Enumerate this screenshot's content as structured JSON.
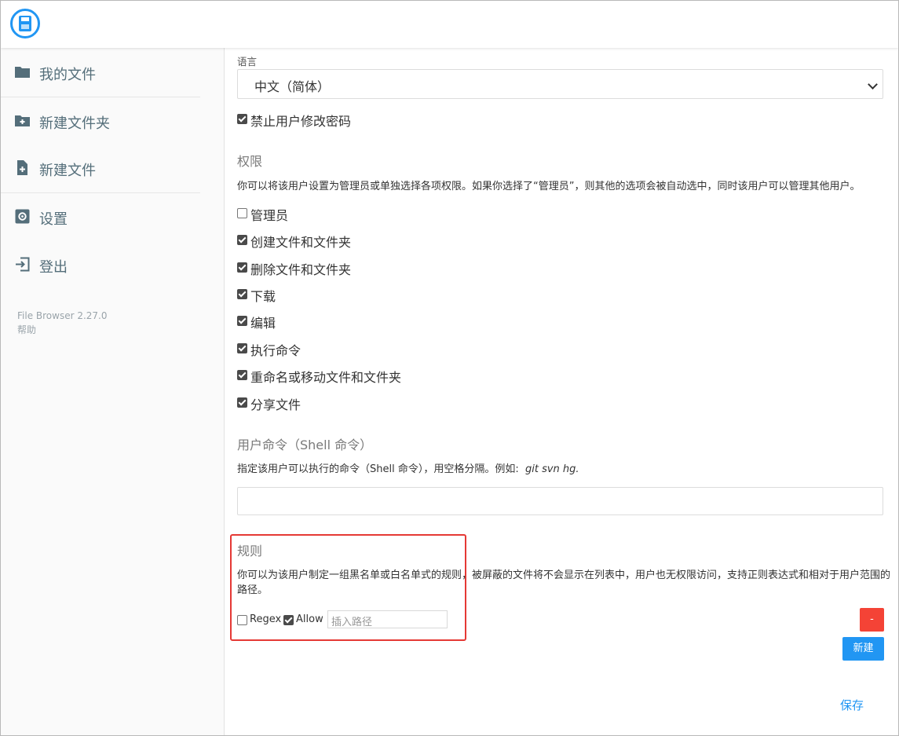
{
  "sidebar": {
    "items": [
      {
        "label": "我的文件",
        "icon": "folder-icon"
      },
      {
        "label": "新建文件夹",
        "icon": "new-folder-icon"
      },
      {
        "label": "新建文件",
        "icon": "new-file-icon"
      },
      {
        "label": "设置",
        "icon": "settings-icon"
      },
      {
        "label": "登出",
        "icon": "logout-icon"
      }
    ],
    "version": "File Browser 2.27.0",
    "help": "帮助"
  },
  "form": {
    "language_label": "语言",
    "language_value": "中文（简体）",
    "lock_password": {
      "label": "禁止用户修改密码",
      "checked": true
    }
  },
  "permissions": {
    "title": "权限",
    "description": "你可以将该用户设置为管理员或单独选择各项权限。如果你选择了“管理员”，则其他的选项会被自动选中，同时该用户可以管理其他用户。",
    "items": [
      {
        "label": "管理员",
        "checked": false
      },
      {
        "label": "创建文件和文件夹",
        "checked": true
      },
      {
        "label": "删除文件和文件夹",
        "checked": true
      },
      {
        "label": "下载",
        "checked": true
      },
      {
        "label": "编辑",
        "checked": true
      },
      {
        "label": "执行命令",
        "checked": true
      },
      {
        "label": "重命名或移动文件和文件夹",
        "checked": true
      },
      {
        "label": "分享文件",
        "checked": true
      }
    ]
  },
  "commands": {
    "title": "用户命令（Shell 命令）",
    "description_prefix": "指定该用户可以执行的命令（Shell 命令），用空格分隔。例如:",
    "example": "git svn hg.",
    "value": ""
  },
  "rules": {
    "title": "规则",
    "description_line1": "你可以为该用户制定一组黑名单或白名单式的规则，被屏蔽的文件将不会显示在列表中，用户也无权限访问，支持正则表达式和相对于用户范围的",
    "description_line2": "路径。",
    "regex_label": "Regex",
    "regex_checked": false,
    "allow_label": "Allow",
    "allow_checked": true,
    "path_placeholder": "插入路径",
    "remove_label": "-",
    "new_label": "新建"
  },
  "save_label": "保存",
  "colors": {
    "accent": "#2196f3",
    "danger": "#f44336",
    "highlight": "#e53935"
  }
}
